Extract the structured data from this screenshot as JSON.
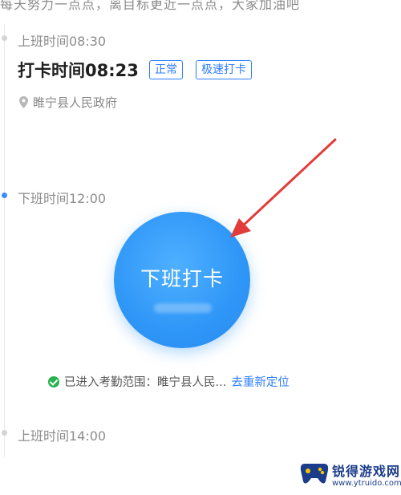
{
  "top_strip_text": "每天努力一点点，离目标更近一点点，大家加油吧",
  "timeline": {
    "morning_schedule": "上班时间08:30",
    "punch_time": "打卡时间08:23",
    "tags": [
      "正常",
      "极速打卡"
    ],
    "location": "睢宁县人民政府",
    "noon_schedule": "下班时间12:00",
    "afternoon_schedule": "上班时间14:00"
  },
  "punch_button": {
    "label": "下班打卡"
  },
  "status": {
    "text": "已进入考勤范围：睢宁县人民...",
    "relocate_link": "去重新定位"
  },
  "watermark": {
    "title": "锐得游戏网",
    "url": "www.ytruido.com"
  },
  "colors": {
    "accent_blue": "#2b7cff",
    "button_blue": "#2e96f7",
    "success_green": "#27b34d",
    "arrow_red": "#e23b3b"
  }
}
